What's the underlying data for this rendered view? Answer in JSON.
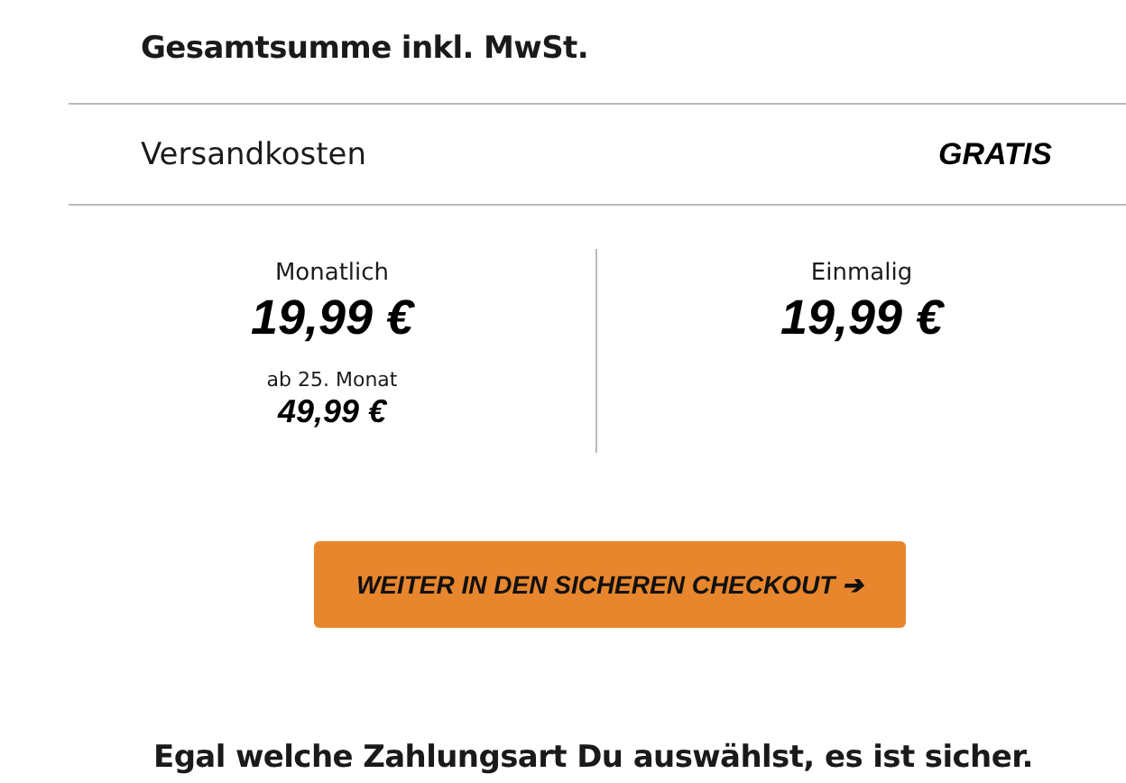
{
  "total_heading": "Gesamtsumme inkl. MwSt.",
  "shipping": {
    "label": "Versandkosten",
    "value": "GRATIS"
  },
  "prices": [
    {
      "label": "Monatlich",
      "amount": "19,99 €",
      "later_label": "ab 25. Monat",
      "later_amount": "49,99 €"
    },
    {
      "label": "Einmalig",
      "amount": "19,99 €"
    }
  ],
  "checkout_button": "WEITER IN DEN SICHEREN CHECKOUT ➔",
  "security_note": "Egal welche Zahlungsart Du auswählst, es ist sicher."
}
